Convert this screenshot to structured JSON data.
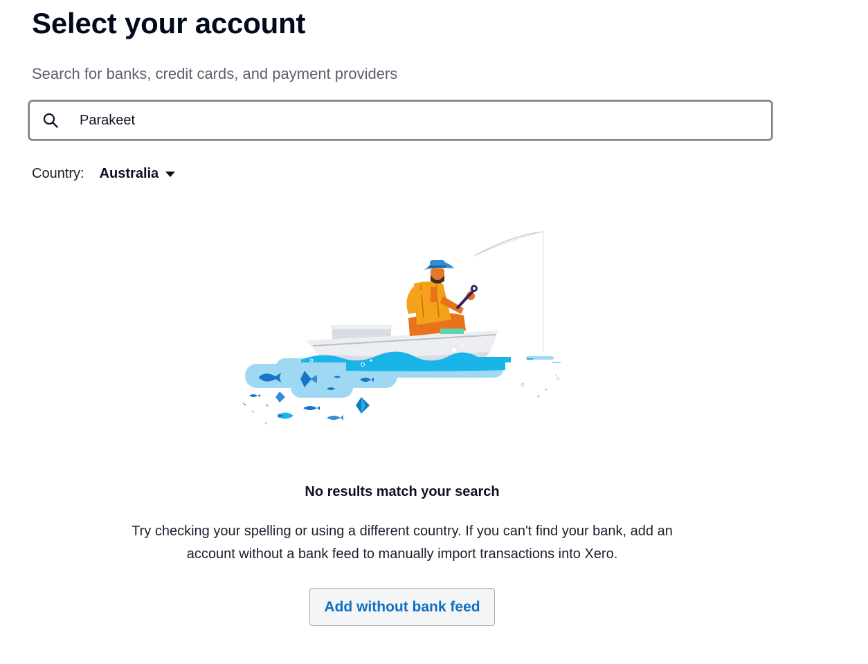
{
  "page": {
    "title": "Select your account",
    "search_hint": "Search for banks, credit cards, and payment providers"
  },
  "search": {
    "value": "Parakeet",
    "icon": "search-icon"
  },
  "country": {
    "label": "Country:",
    "selected": "Australia",
    "icon": "caret-down-icon"
  },
  "empty_state": {
    "illustration": "fisherman-in-boat-illustration",
    "title": "No results match your search",
    "body": "Try checking your spelling or using a different country. If you can't find your bank, add an account without a bank feed to manually import transactions into Xero."
  },
  "actions": {
    "add_without_feed_label": "Add without bank feed"
  },
  "colors": {
    "accent_blue": "#0f6ec2",
    "water_light": "#9fd8f2",
    "water_dark": "#1ab4e8",
    "shirt_orange": "#f5a11b",
    "pants_orange": "#e8731c"
  }
}
